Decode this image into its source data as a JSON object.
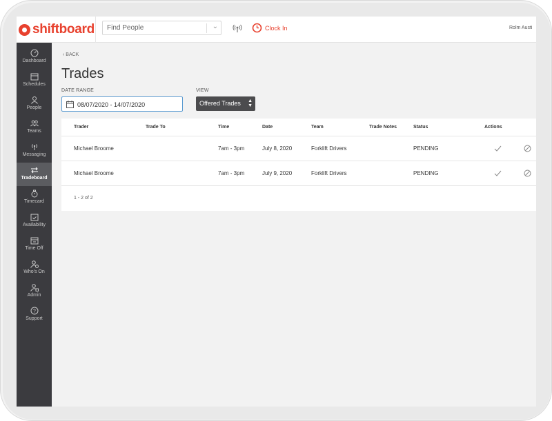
{
  "header": {
    "logo_text": "shiftboard",
    "search_placeholder": "Find People",
    "clock_in_label": "Clock In",
    "user_name": "Rolm Austi"
  },
  "sidebar": {
    "items": [
      {
        "label": "Dashboard",
        "icon": "dashboard-icon",
        "active": false
      },
      {
        "label": "Schedules",
        "icon": "calendar-icon",
        "active": false
      },
      {
        "label": "People",
        "icon": "person-icon",
        "active": false
      },
      {
        "label": "Teams",
        "icon": "teams-icon",
        "active": false
      },
      {
        "label": "Messaging",
        "icon": "signal-icon",
        "active": false
      },
      {
        "label": "Tradeboard",
        "icon": "swap-icon",
        "active": true
      },
      {
        "label": "Timecard",
        "icon": "stopwatch-icon",
        "active": false
      },
      {
        "label": "Availability",
        "icon": "calendar-check-icon",
        "active": false
      },
      {
        "label": "Time Off",
        "icon": "calendar-icon",
        "active": false
      },
      {
        "label": "Who's On",
        "icon": "person-clock-icon",
        "active": false
      },
      {
        "label": "Admin",
        "icon": "admin-icon",
        "active": false
      },
      {
        "label": "Support",
        "icon": "help-icon",
        "active": false
      }
    ]
  },
  "main": {
    "back_label": "BACK",
    "title": "Trades",
    "date_range_label": "DATE RANGE",
    "date_range_value": "08/07/2020 - 14/07/2020",
    "view_label": "VIEW",
    "view_value": "Offered Trades"
  },
  "table": {
    "columns": [
      "Trader",
      "Trade To",
      "Time",
      "Date",
      "Team",
      "Trade Notes",
      "Status",
      "Actions"
    ],
    "rows": [
      {
        "trader": "Michael Broome",
        "trade_to": "",
        "time": "7am - 3pm",
        "date": "July 8, 2020",
        "team": "Forklift Drivers",
        "notes": "",
        "status": "PENDING"
      },
      {
        "trader": "Michael Broome",
        "trade_to": "",
        "time": "7am - 3pm",
        "date": "July 9, 2020",
        "team": "Forklift Drivers",
        "notes": "",
        "status": "PENDING"
      }
    ],
    "pagination": "1 - 2 of 2"
  },
  "colors": {
    "brand": "#e8412e",
    "sidebar_bg": "#3b3b3f",
    "sidebar_active": "#5b5c60",
    "input_focus": "#5b9bd1"
  }
}
